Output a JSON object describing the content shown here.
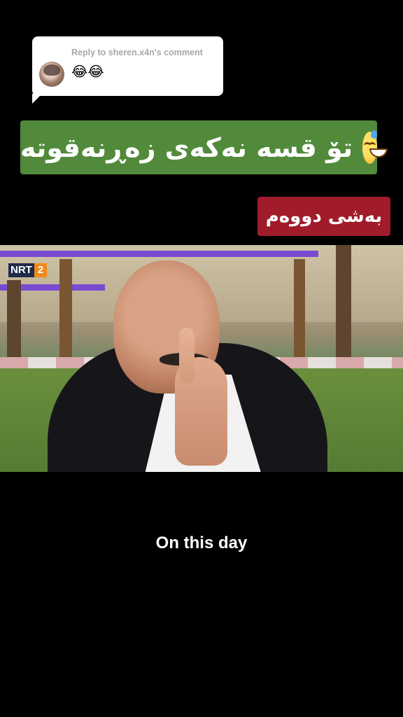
{
  "reply": {
    "label": "Reply to sheren.x4n's comment",
    "comment": "😂😂"
  },
  "title_banner": {
    "text": "تۆ قسە نەکەی زەڕنەقوتە",
    "emoji": "grinning-sweat-emoji",
    "color": "#528a3b"
  },
  "part_badge": {
    "text": "بەشی دووەم",
    "color": "#a01c2a"
  },
  "video": {
    "channel_logo_left": "NRT",
    "channel_logo_right": "2"
  },
  "caption": {
    "text": "On this day"
  }
}
